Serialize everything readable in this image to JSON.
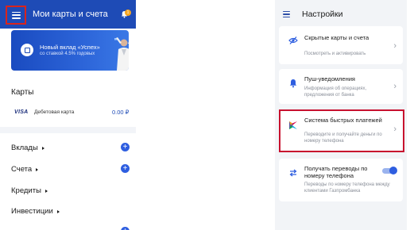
{
  "left": {
    "header": {
      "title": "Мои карты и счета",
      "bell_badge": "1"
    },
    "promo": {
      "title": "Новый вклад «Успех»",
      "subtitle": "со ставкой 4.5% годовых"
    },
    "cards_section": {
      "title": "Карты",
      "items": [
        {
          "brand": "VISA",
          "name": "Дебетовая карта",
          "amount": "0.00 ₽"
        }
      ]
    },
    "categories": [
      {
        "label": "Вклады",
        "has_add": true
      },
      {
        "label": "Счета",
        "has_add": true
      },
      {
        "label": "Кредиты",
        "has_add": false
      },
      {
        "label": "Инвестиции",
        "has_add": false
      }
    ]
  },
  "right": {
    "header": {
      "title": "Настройки"
    },
    "items": [
      {
        "title": "Скрытые карты и счета",
        "desc": "Посмотреть и активировать",
        "icon": "eye-off-icon"
      },
      {
        "title": "Пуш-уведомления",
        "desc": "Информация об операциях, предложения от банка",
        "icon": "bell-icon"
      },
      {
        "title": "Система быстрых платежей",
        "desc": "Переводите и получайте деньги по номеру телефона",
        "icon": "sbp-logo-icon"
      },
      {
        "title": "Получать переводы по номеру телефона",
        "desc": "Переводы по номеру телефона между клиентами Газпромбанка",
        "icon": "transfer-icon",
        "toggle": "on"
      }
    ]
  },
  "colors": {
    "brand_blue": "#1e4bb6",
    "accent_blue": "#2e5ee0",
    "highlight_red": "#c8102e"
  }
}
